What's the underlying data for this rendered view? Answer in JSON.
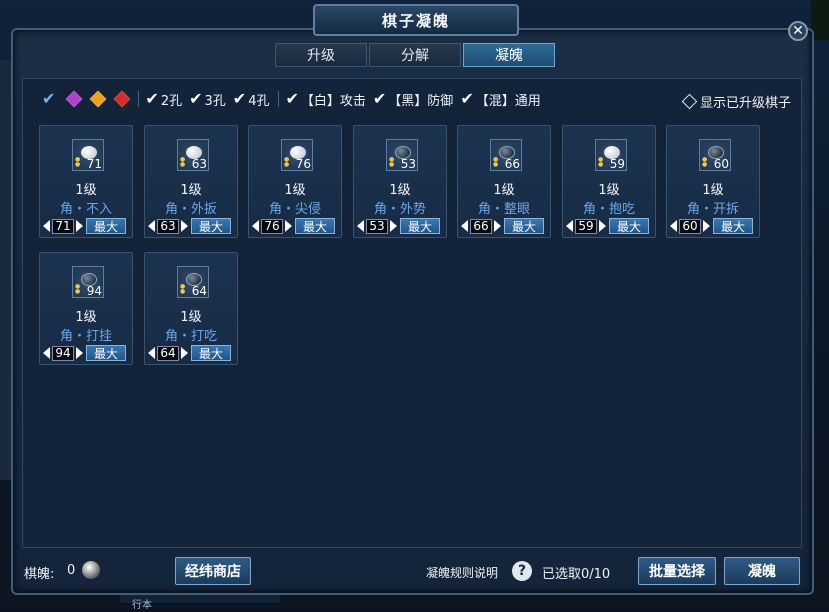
{
  "window": {
    "title": "棋子凝魄",
    "close_glyph": "✕"
  },
  "tabs": [
    {
      "label": "升级",
      "active": false
    },
    {
      "label": "分解",
      "active": false
    },
    {
      "label": "凝魄",
      "active": true
    }
  ],
  "filters": {
    "gem_colors": [
      "#b43fcf",
      "#f0a21a",
      "#d82c2c"
    ],
    "holes": [
      "2孔",
      "3孔",
      "4孔"
    ],
    "types": [
      "【白】攻击",
      "【黑】防御",
      "【混】通用"
    ],
    "show_upgraded": "显示已升级棋子"
  },
  "cards": [
    {
      "stone": "white",
      "count": "71",
      "level": "1级",
      "name": "角・不入",
      "qty": "71",
      "max_label": "最大"
    },
    {
      "stone": "white",
      "count": "63",
      "level": "1级",
      "name": "角・外扳",
      "qty": "63",
      "max_label": "最大"
    },
    {
      "stone": "white",
      "count": "76",
      "level": "1级",
      "name": "角・尖侵",
      "qty": "76",
      "max_label": "最大"
    },
    {
      "stone": "black",
      "count": "53",
      "level": "1级",
      "name": "角・外势",
      "qty": "53",
      "max_label": "最大"
    },
    {
      "stone": "black",
      "count": "66",
      "level": "1级",
      "name": "角・整眼",
      "qty": "66",
      "max_label": "最大"
    },
    {
      "stone": "white",
      "count": "59",
      "level": "1级",
      "name": "角・抱吃",
      "qty": "59",
      "max_label": "最大"
    },
    {
      "stone": "black",
      "count": "60",
      "level": "1级",
      "name": "角・开拆",
      "qty": "60",
      "max_label": "最大"
    },
    {
      "stone": "black",
      "count": "94",
      "level": "1级",
      "name": "角・打挂",
      "qty": "94",
      "max_label": "最大"
    },
    {
      "stone": "black",
      "count": "64",
      "level": "1级",
      "name": "角・打吃",
      "qty": "64",
      "max_label": "最大"
    }
  ],
  "footer": {
    "soul_label": "棋魄:",
    "soul_value": "0",
    "shop_button": "经纬商店",
    "rules_label": "凝魄规则说明",
    "help_glyph": "?",
    "selected_text": "已选取0/10",
    "batch_button": "批量选择",
    "condense_button": "凝魄"
  },
  "background": {
    "bottom_tab": "行本"
  }
}
